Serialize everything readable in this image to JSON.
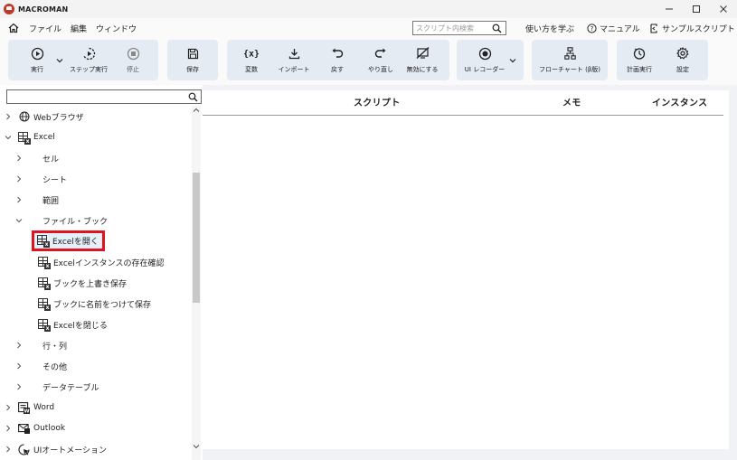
{
  "app": {
    "title": "MACROMAN",
    "brand_color": "#c0392b"
  },
  "window": {
    "minimize": "—",
    "maximize": "☐",
    "close": "✕"
  },
  "menubar": {
    "items": [
      "ファイル",
      "編集",
      "ウィンドウ"
    ],
    "search_placeholder": "スクリプト内検索",
    "help_label": "使い方を学ぶ",
    "manual_label": "マニュアル",
    "sample_label": "サンプルスクリプト"
  },
  "toolbar": {
    "run": "実行",
    "step_run": "ステップ実行",
    "stop": "停止",
    "save": "保存",
    "variables": "変数",
    "import": "インポート",
    "undo": "戻す",
    "redo": "やり直し",
    "disable": "無効にする",
    "ui_recorder": "UI レコーダー",
    "flowchart": "フローチャート (β版)",
    "scheduled_run": "計画実行",
    "settings": "設定"
  },
  "tree": {
    "search_value": "",
    "nodes": [
      {
        "label": "Webブラウザ",
        "level": 0,
        "expanded": false,
        "icon": "globe-icon"
      },
      {
        "label": "Excel",
        "level": 0,
        "expanded": true,
        "icon": "excel-icon"
      },
      {
        "label": "セル",
        "level": 1,
        "expanded": false
      },
      {
        "label": "シート",
        "level": 1,
        "expanded": false
      },
      {
        "label": "範囲",
        "level": 1,
        "expanded": false
      },
      {
        "label": "ファイル・ブック",
        "level": 1,
        "expanded": true
      },
      {
        "label": "Excelを開く",
        "level": 2,
        "icon": "excel-icon",
        "selected": true
      },
      {
        "label": "Excelインスタンスの存在確認",
        "level": 2,
        "icon": "excel-icon"
      },
      {
        "label": "ブックを上書き保存",
        "level": 2,
        "icon": "excel-icon"
      },
      {
        "label": "ブックに名前をつけて保存",
        "level": 2,
        "icon": "excel-icon"
      },
      {
        "label": "Excelを閉じる",
        "level": 2,
        "icon": "excel-icon"
      },
      {
        "label": "行・列",
        "level": 1,
        "expanded": false
      },
      {
        "label": "その他",
        "level": 1,
        "expanded": false
      },
      {
        "label": "データテーブル",
        "level": 1,
        "expanded": false
      },
      {
        "label": "Word",
        "level": 0,
        "expanded": false,
        "icon": "word-icon"
      },
      {
        "label": "Outlook",
        "level": 0,
        "expanded": false,
        "icon": "mail-icon"
      },
      {
        "label": "UIオートメーション",
        "level": 0,
        "expanded": false,
        "icon": "cursor-icon"
      }
    ]
  },
  "main": {
    "columns": [
      "スクリプト",
      "メモ",
      "インスタンス"
    ]
  },
  "colors": {
    "highlight": "#e0141e",
    "toolbar_group": "#e4ebf3"
  }
}
